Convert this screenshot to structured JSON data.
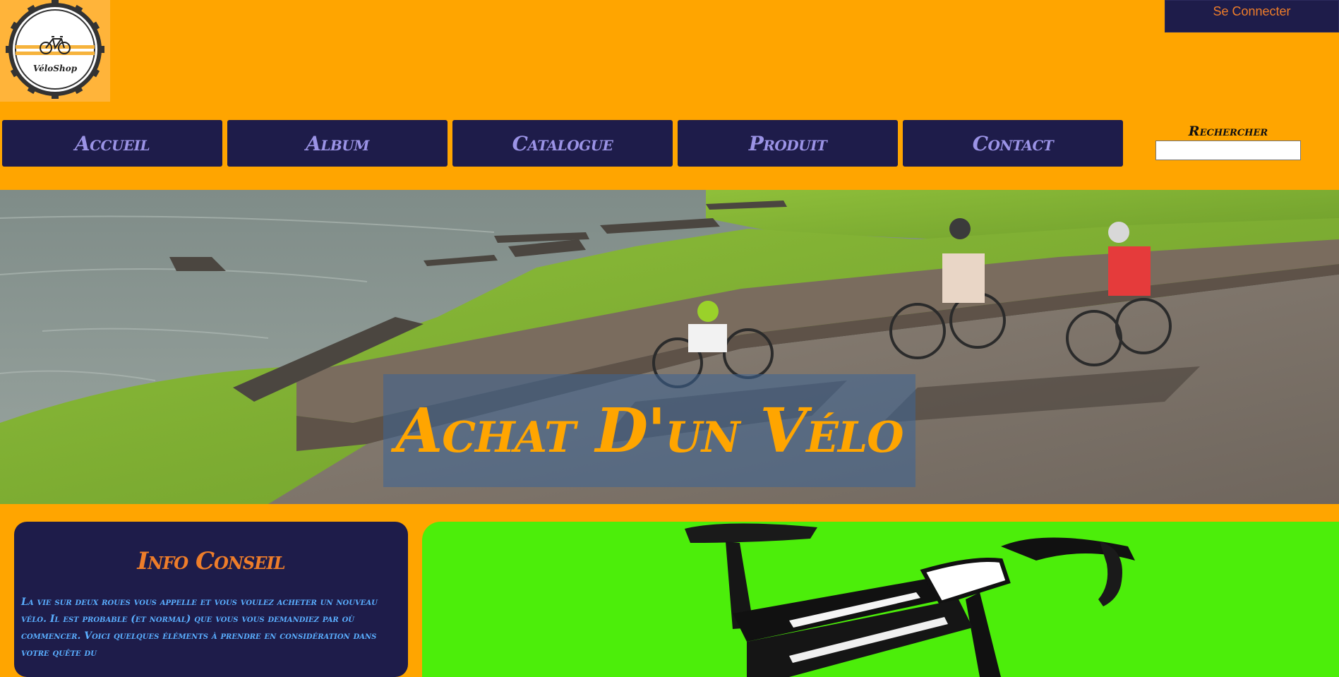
{
  "colors": {
    "page_background": "#ffa500",
    "nav_background": "#1e1c4a",
    "nav_text": "#9b93e6",
    "accent_orange": "#ee7d2a",
    "info_text": "#5aaeff",
    "product_background": "#4cee0a"
  },
  "logo": {
    "text": "VéloShop",
    "icon": "bicycle-gear-logo"
  },
  "header": {
    "login_label": "Se Connecter"
  },
  "nav": {
    "items": [
      {
        "label": "Accueil"
      },
      {
        "label": "Album"
      },
      {
        "label": "Catalogue"
      },
      {
        "label": "Produit"
      },
      {
        "label": "Contact"
      }
    ]
  },
  "search": {
    "label": "Rechercher",
    "value": "",
    "placeholder": ""
  },
  "hero": {
    "title": "Achat D'un Vélo",
    "image": "family-cycling-by-river-photo"
  },
  "info": {
    "title": "Info Conseil",
    "text": "La vie sur deux roues vous appelle et vous voulez acheter un nouveau vélo. Il est probable (et normal) que vous vous demandiez par où commencer. Voici quelques éléments à prendre en considération dans votre quête du"
  },
  "product": {
    "image": "road-bike-photo"
  }
}
